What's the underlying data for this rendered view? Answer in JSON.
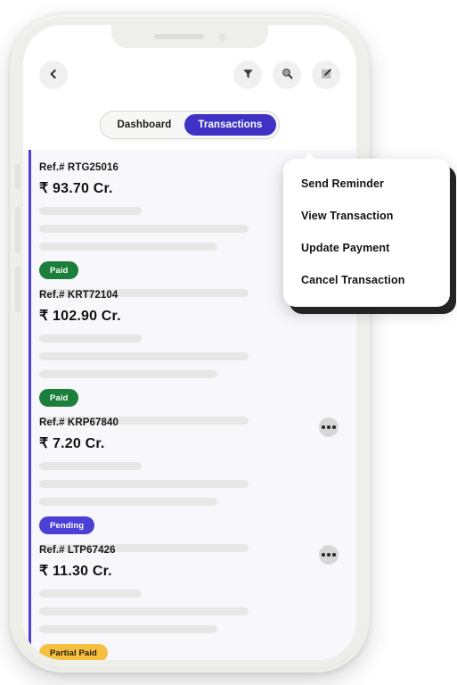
{
  "device": {
    "frame_color": "#eeeeea",
    "screen_bg": "#ffffff"
  },
  "topbar": {
    "back_label": "Back",
    "filter_label": "Filter",
    "search_label": "Search",
    "edit_label": "Edit"
  },
  "segment": {
    "tabs": [
      {
        "label": "Dashboard",
        "active": false
      },
      {
        "label": "Transactions",
        "active": true
      }
    ],
    "active_color": "#3f32c4"
  },
  "list": {
    "accent_color": "#4b3fd6",
    "background": "#f8f8fc",
    "cards": [
      {
        "ref": "Ref.# RTG25016",
        "amount": "₹ 93.70 Cr.",
        "status": "Paid",
        "status_type": "paid",
        "status_color": "#1b7f3b",
        "has_menu_button": true
      },
      {
        "ref": "Ref.# KRT72104",
        "amount": "₹ 102.90 Cr.",
        "status": "Paid",
        "status_type": "paid",
        "status_color": "#1b7f3b",
        "has_menu_button": false
      },
      {
        "ref": "Ref.# KRP67840",
        "amount": "₹ 7.20 Cr.",
        "status": "Pending",
        "status_type": "pending",
        "status_color": "#4b3fd6",
        "has_menu_button": true
      },
      {
        "ref": "Ref.# LTP67426",
        "amount": "₹ 11.30 Cr.",
        "status": "Partial Paid",
        "status_type": "partial",
        "status_color": "#f5c040",
        "has_menu_button": true
      }
    ]
  },
  "context_menu": {
    "visible": true,
    "items": [
      {
        "label": "Send Reminder"
      },
      {
        "label": "View Transaction"
      },
      {
        "label": "Update Payment"
      },
      {
        "label": "Cancel Transaction"
      }
    ]
  }
}
